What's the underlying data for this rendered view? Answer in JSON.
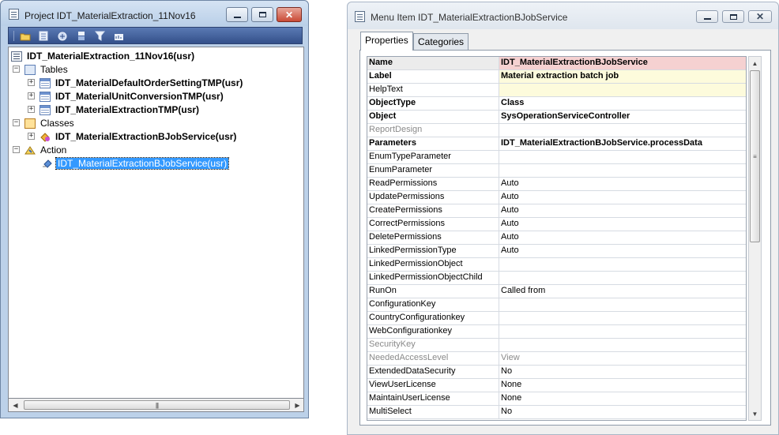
{
  "project_window": {
    "title": "Project IDT_MaterialExtraction_11Nov16",
    "root": "IDT_MaterialExtraction_11Nov16(usr)",
    "groups": [
      {
        "label": "Tables",
        "items": [
          "IDT_MaterialDefaultOrderSettingTMP(usr)",
          "IDT_MaterialUnitConversionTMP(usr)",
          "IDT_MaterialExtractionTMP(usr)"
        ]
      },
      {
        "label": "Classes",
        "items": [
          "IDT_MaterialExtractionBJobService(usr)"
        ]
      },
      {
        "label": "Action",
        "items": [
          "IDT_MaterialExtractionBJobService(usr)"
        ]
      }
    ]
  },
  "menu_item_window": {
    "title": "Menu Item IDT_MaterialExtractionBJobService",
    "tabs": [
      "Properties",
      "Categories"
    ],
    "properties": [
      {
        "name": "Name",
        "value": "IDT_MaterialExtractionBJobService",
        "style": "bold"
      },
      {
        "name": "Label",
        "value": "Material extraction batch job",
        "style": "bold"
      },
      {
        "name": "HelpText",
        "value": "",
        "style": "normal"
      },
      {
        "name": "ObjectType",
        "value": "Class",
        "style": "bold"
      },
      {
        "name": "Object",
        "value": "SysOperationServiceController",
        "style": "bold"
      },
      {
        "name": "ReportDesign",
        "value": "",
        "style": "gray"
      },
      {
        "name": "Parameters",
        "value": "IDT_MaterialExtractionBJobService.processData",
        "style": "bold"
      },
      {
        "name": "EnumTypeParameter",
        "value": "",
        "style": "normal"
      },
      {
        "name": "EnumParameter",
        "value": "",
        "style": "normal"
      },
      {
        "name": "ReadPermissions",
        "value": "Auto",
        "style": "normal"
      },
      {
        "name": "UpdatePermissions",
        "value": "Auto",
        "style": "normal"
      },
      {
        "name": "CreatePermissions",
        "value": "Auto",
        "style": "normal"
      },
      {
        "name": "CorrectPermissions",
        "value": "Auto",
        "style": "normal"
      },
      {
        "name": "DeletePermissions",
        "value": "Auto",
        "style": "normal"
      },
      {
        "name": "LinkedPermissionType",
        "value": "Auto",
        "style": "normal"
      },
      {
        "name": "LinkedPermissionObject",
        "value": "",
        "style": "normal"
      },
      {
        "name": "LinkedPermissionObjectChild",
        "value": "",
        "style": "normal"
      },
      {
        "name": "RunOn",
        "value": "Called from",
        "style": "normal"
      },
      {
        "name": "ConfigurationKey",
        "value": "",
        "style": "normal"
      },
      {
        "name": "CountryConfigurationkey",
        "value": "",
        "style": "normal"
      },
      {
        "name": "WebConfigurationkey",
        "value": "",
        "style": "normal"
      },
      {
        "name": "SecurityKey",
        "value": "",
        "style": "gray"
      },
      {
        "name": "NeededAccessLevel",
        "value": "View",
        "style": "gray"
      },
      {
        "name": "ExtendedDataSecurity",
        "value": "No",
        "style": "normal"
      },
      {
        "name": "ViewUserLicense",
        "value": "None",
        "style": "normal"
      },
      {
        "name": "MaintainUserLicense",
        "value": "None",
        "style": "normal"
      },
      {
        "name": "MultiSelect",
        "value": "No",
        "style": "normal"
      }
    ]
  },
  "colors": {
    "left_frame": "#bcd1e9",
    "toolbar": "#3d5a93",
    "selection": "#3399ff",
    "name_row": "#f5d1d1",
    "label_row": "#fdfbdc"
  }
}
